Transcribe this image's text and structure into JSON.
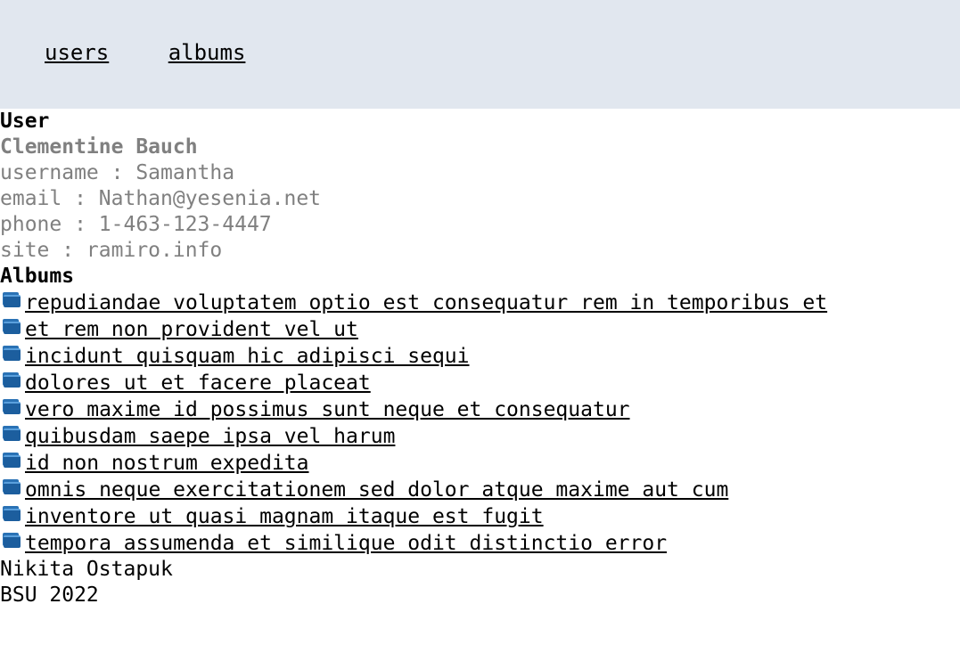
{
  "nav": {
    "users_label": "users",
    "albums_label": "albums"
  },
  "user_section": {
    "title": "User",
    "name": "Clementine Bauch",
    "username": "username : Samantha",
    "email": "email : Nathan@yesenia.net",
    "phone": "phone : 1-463-123-4447",
    "site": "site : ramiro.info"
  },
  "albums_section": {
    "title": "Albums",
    "icon": "folder-icon",
    "items": [
      "repudiandae voluptatem optio est consequatur rem in temporibus et",
      "et rem non provident vel ut",
      "incidunt quisquam hic adipisci sequi",
      "dolores ut et facere placeat",
      "vero maxime id possimus sunt neque et consequatur",
      "quibusdam saepe ipsa vel harum",
      "id non nostrum expedita",
      "omnis neque exercitationem sed dolor atque maxime aut cum",
      "inventore ut quasi magnam itaque est fugit",
      "tempora assumenda et similique odit distinctio error"
    ]
  },
  "footer": {
    "author": "Nikita Ostapuk",
    "org_year": "BSU 2022"
  },
  "colors": {
    "nav_background": "#e1e7ef",
    "muted_text": "#808080",
    "icon_blue": "#1c5e9e"
  }
}
